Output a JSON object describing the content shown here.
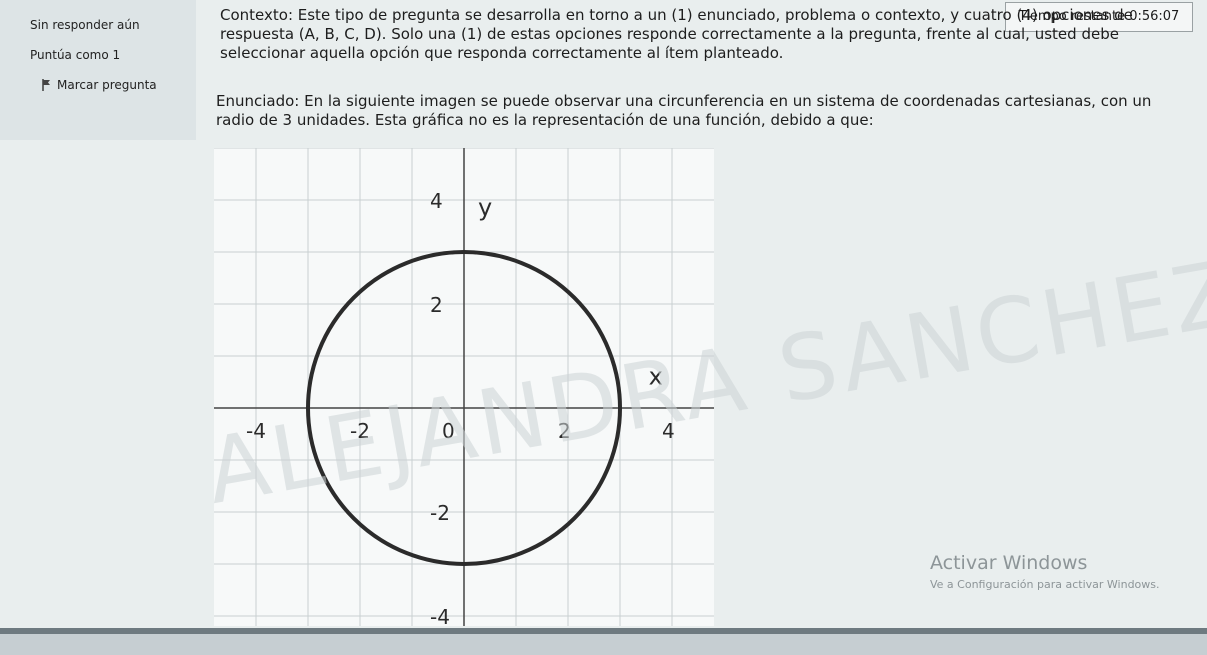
{
  "sidebar": {
    "status": "Sin responder aún",
    "score": "Puntúa como 1",
    "flag_label": "Marcar pregunta"
  },
  "timer": {
    "label": "Tiempo restante",
    "value": "0:56:07"
  },
  "question": {
    "context_label": "Contexto:",
    "context_text": " Este tipo de pregunta se desarrolla en torno a un (1) enunciado, problema o contexto, y cuatro (4) opciones de respuesta (A, B, C, D). Solo una (1) de estas opciones responde correctamente a la pregunta, frente al cual, usted debe seleccionar aquella opción que responda correctamente al ítem planteado.",
    "statement_label": "Enunciado:",
    "statement_text": " En la siguiente imagen se puede observar una circunferencia en un sistema de coordenadas cartesianas, con un radio de 3 unidades. Esta gráfica no es la representación de una función, debido a que:"
  },
  "graph": {
    "x_axis_label": "x",
    "y_axis_label": "y",
    "x_ticks": [
      "-4",
      "-2",
      "0",
      "2",
      "4"
    ],
    "y_ticks": [
      "4",
      "2",
      "-2",
      "-4"
    ],
    "circle": {
      "center": [
        0,
        0
      ],
      "radius": 3
    },
    "x_range": [
      -4.5,
      5
    ],
    "y_range": [
      -4.3,
      5
    ]
  },
  "watermark": "ALEJANDRA SANCHEZ",
  "os_notice": {
    "title": "Activar Windows",
    "subtitle": "Ve a Configuración para activar Windows."
  }
}
